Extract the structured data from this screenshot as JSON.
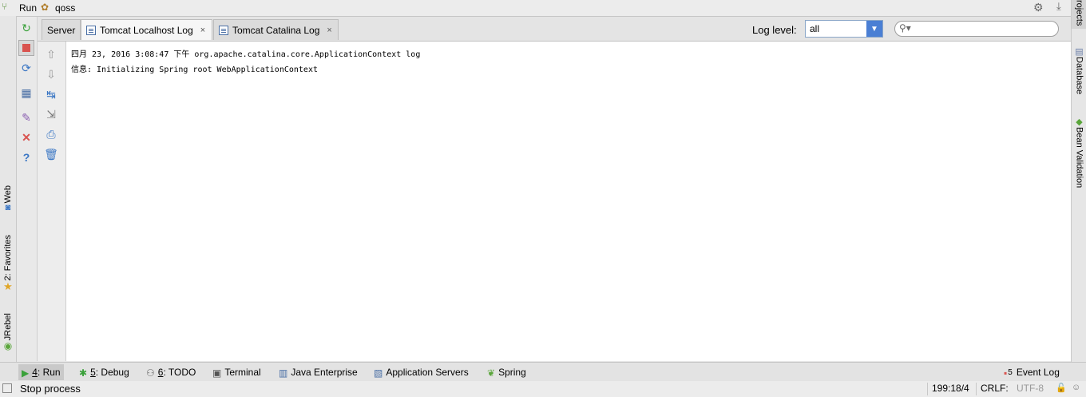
{
  "run_header": {
    "title": "Run",
    "config_name": "qoss"
  },
  "left_stripe": {
    "tabs": [
      {
        "label": "Web"
      },
      {
        "label": "2: Favorites"
      },
      {
        "label": "JRebel"
      }
    ]
  },
  "right_stripe": {
    "tabs": [
      {
        "label": "rojects"
      },
      {
        "label": "Database"
      },
      {
        "label": "Bean Validation"
      }
    ]
  },
  "tabs": [
    {
      "label": "Server"
    },
    {
      "label": "Tomcat Localhost Log",
      "close": "×"
    },
    {
      "label": "Tomcat Catalina Log",
      "close": "×"
    }
  ],
  "log_level": {
    "label": "Log level:",
    "value": "all"
  },
  "search": {
    "placeholder": ""
  },
  "console": {
    "lines": [
      "四月 23, 2016 3:08:47 下午 org.apache.catalina.core.ApplicationContext log",
      "信息: Initializing Spring root WebApplicationContext"
    ]
  },
  "bottom_tabs": [
    {
      "mnemonic": "4",
      "label": ": Run"
    },
    {
      "mnemonic": "5",
      "label": ": Debug"
    },
    {
      "mnemonic": "6",
      "label": ": TODO"
    },
    {
      "label": "Terminal"
    },
    {
      "label": "Java Enterprise"
    },
    {
      "label": "Application Servers"
    },
    {
      "label": "Spring"
    }
  ],
  "event_log": {
    "badge": "5",
    "label": "Event Log"
  },
  "status": {
    "message": "Stop process",
    "position": "199:18/4",
    "line_separator": "CRLF:",
    "encoding": "UTF-8"
  },
  "colors": {
    "accent": "#4a7fd4",
    "stop": "#d9534f",
    "run_green": "#3aa13a"
  }
}
